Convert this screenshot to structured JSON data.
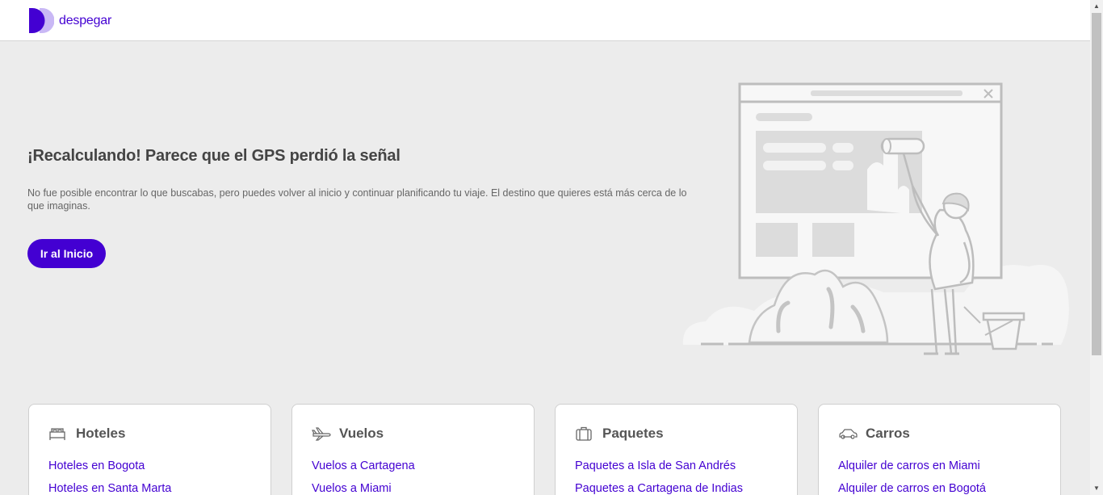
{
  "header": {
    "brand": "despegar"
  },
  "error": {
    "title": "¡Recalculando! Parece que el GPS perdió la señal",
    "description": "No fue posible encontrar lo que buscabas, pero puedes volver al inicio y continuar planificando tu viaje. El destino que quieres está más cerca de lo que imaginas.",
    "button": "Ir al Inicio"
  },
  "cards": [
    {
      "title": "Hoteles",
      "icon": "bed-icon",
      "links": [
        "Hoteles en Bogota",
        "Hoteles en Santa Marta"
      ]
    },
    {
      "title": "Vuelos",
      "icon": "airplane-icon",
      "links": [
        "Vuelos a Cartagena",
        "Vuelos a Miami"
      ]
    },
    {
      "title": "Paquetes",
      "icon": "suitcase-icon",
      "links": [
        "Paquetes a Isla de San Andrés",
        "Paquetes a Cartagena de Indias"
      ]
    },
    {
      "title": "Carros",
      "icon": "car-icon",
      "links": [
        "Alquiler de carros en Miami",
        "Alquiler de carros en Bogotá"
      ]
    }
  ],
  "colors": {
    "brand": "#4300d2",
    "brand_light": "#c9b8f5",
    "background": "#ececec"
  }
}
